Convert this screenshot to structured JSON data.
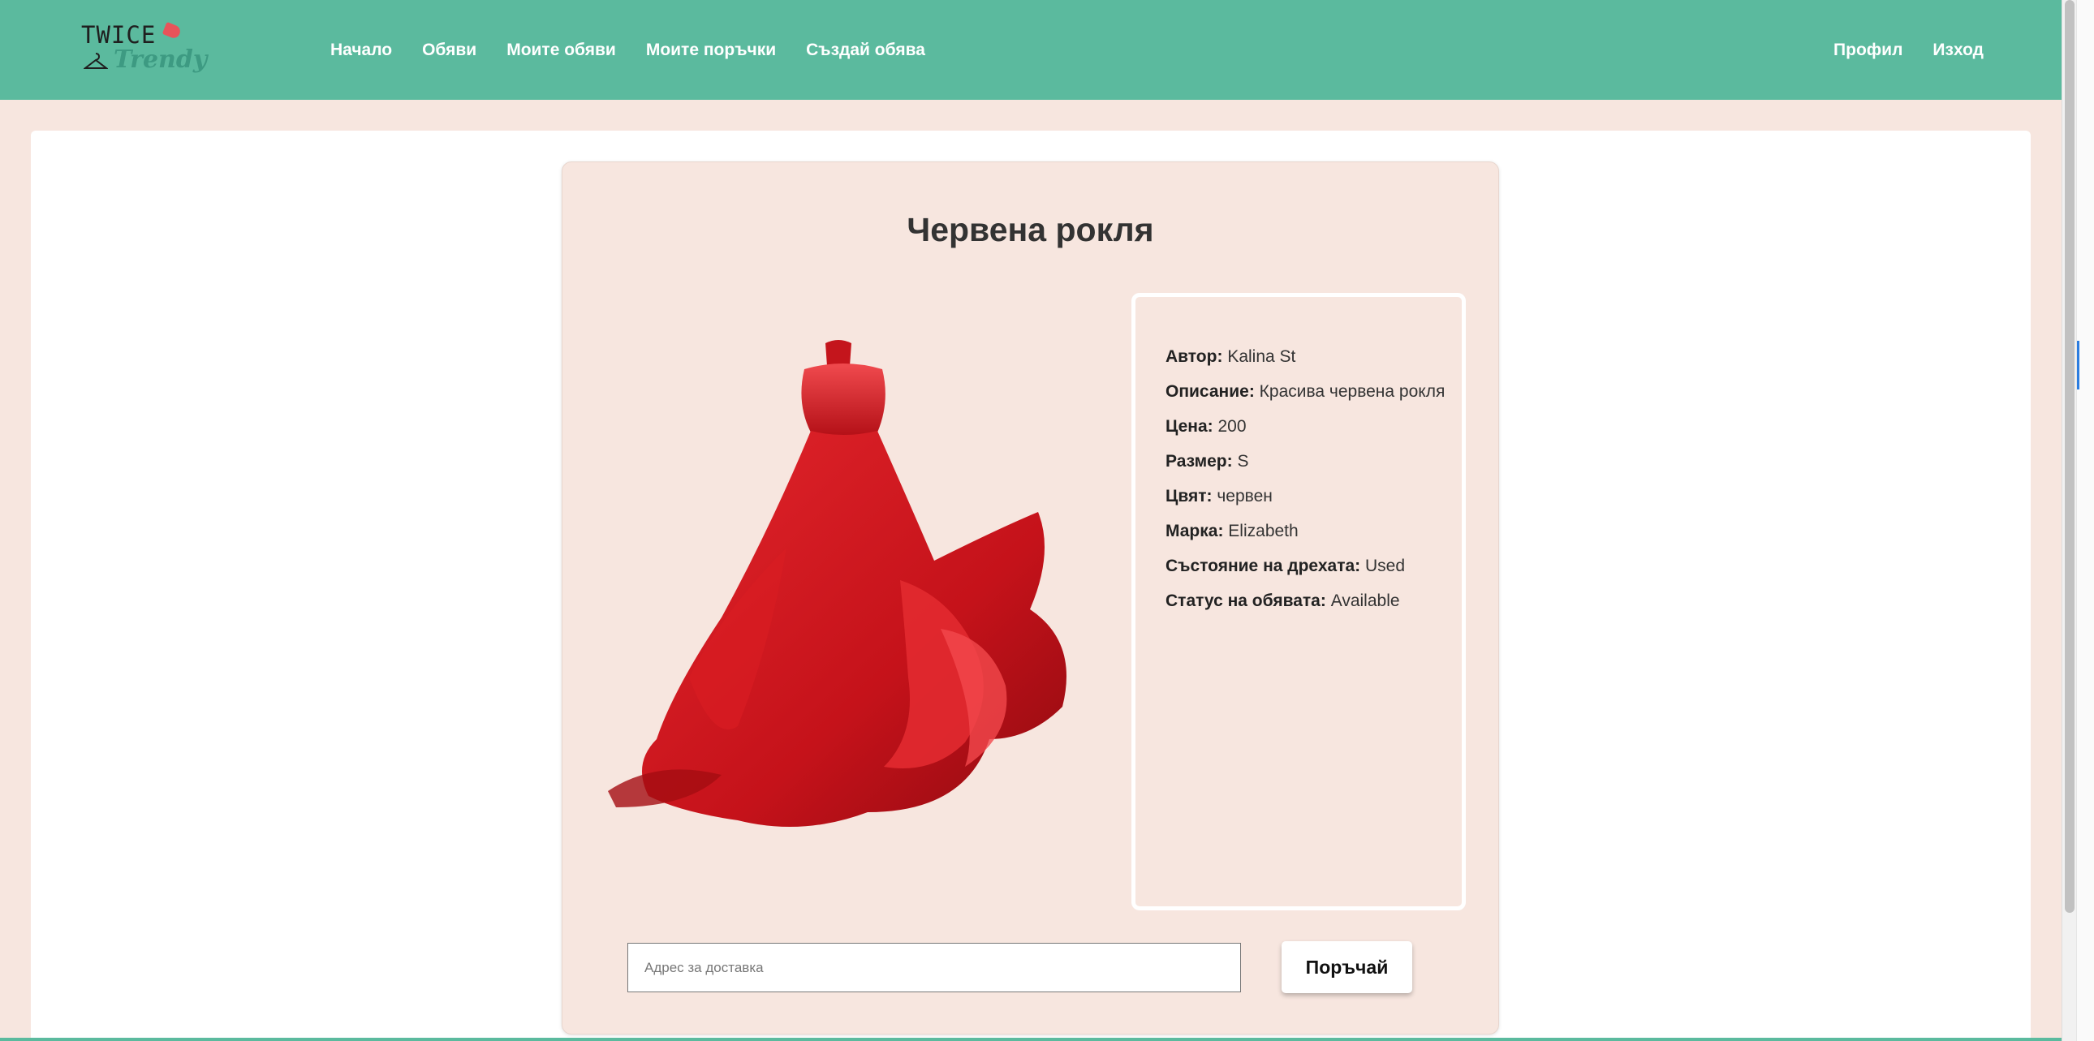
{
  "header": {
    "logo": {
      "line1": "TWICE",
      "line2": "Trendy"
    },
    "nav": [
      {
        "label": "Начало"
      },
      {
        "label": "Обяви"
      },
      {
        "label": "Моите обяви"
      },
      {
        "label": "Моите поръчки"
      },
      {
        "label": "Създай обява"
      }
    ],
    "nav_right": [
      {
        "label": "Профил"
      },
      {
        "label": "Изход"
      }
    ]
  },
  "listing": {
    "title": "Червена рокля",
    "image_icon": "red-dress-image",
    "details": [
      {
        "label": "Автор:",
        "value": "Kalina St"
      },
      {
        "label": "Описание:",
        "value": "Красива червена рокля"
      },
      {
        "label": "Цена:",
        "value": "200"
      },
      {
        "label": "Размер:",
        "value": "S"
      },
      {
        "label": "Цвят:",
        "value": "червен"
      },
      {
        "label": "Марка:",
        "value": "Elizabeth"
      },
      {
        "label": "Състояние на дрехата:",
        "value": "Used"
      },
      {
        "label": "Статус на обявата:",
        "value": "Available"
      }
    ]
  },
  "order": {
    "address_placeholder": "Адрес за доставка",
    "address_value": "",
    "button_label": "Поръчай"
  },
  "colors": {
    "header_bg": "#5bba9e",
    "page_bg": "#f7e6df",
    "dress_red": "#d8141c"
  }
}
